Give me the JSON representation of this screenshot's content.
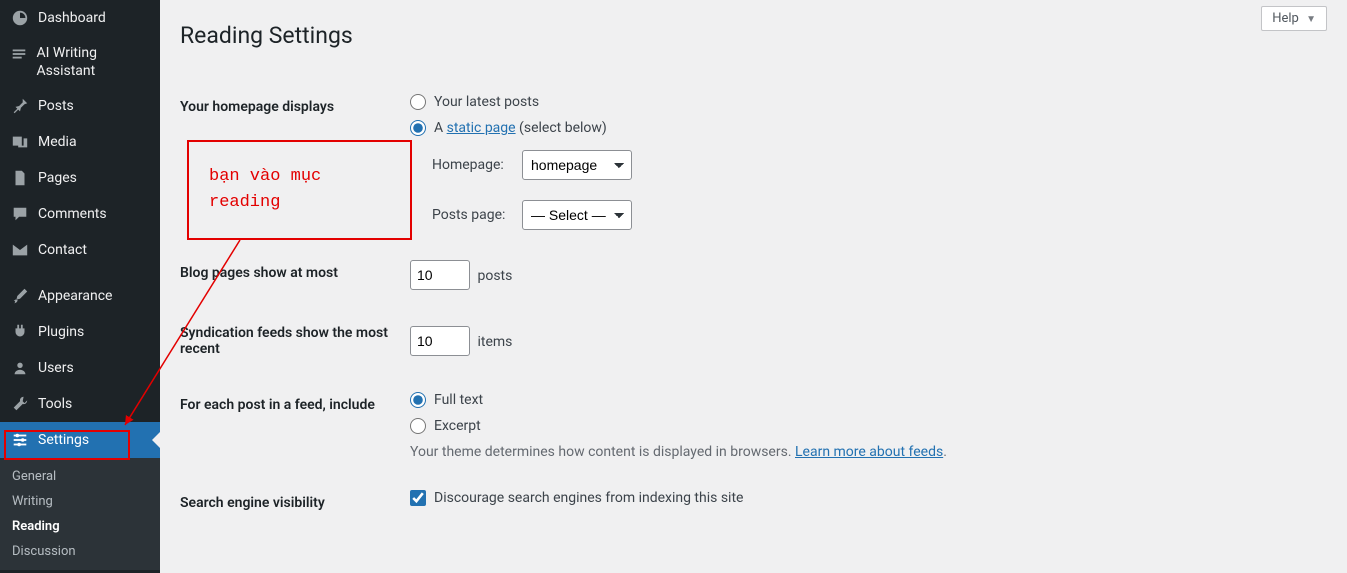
{
  "help_label": "Help",
  "page_title": "Reading Settings",
  "sidebar": {
    "items": [
      {
        "label": "Dashboard"
      },
      {
        "label": "AI Writing Assistant"
      },
      {
        "label": "Posts"
      },
      {
        "label": "Media"
      },
      {
        "label": "Pages"
      },
      {
        "label": "Comments"
      },
      {
        "label": "Contact"
      },
      {
        "label": "Appearance"
      },
      {
        "label": "Plugins"
      },
      {
        "label": "Users"
      },
      {
        "label": "Tools"
      },
      {
        "label": "Settings"
      }
    ],
    "submenu": [
      {
        "label": "General"
      },
      {
        "label": "Writing"
      },
      {
        "label": "Reading"
      },
      {
        "label": "Discussion"
      }
    ]
  },
  "form": {
    "homepage_displays_label": "Your homepage displays",
    "opt_latest_posts": "Your latest posts",
    "opt_static_prefix": "A ",
    "opt_static_link": "static page",
    "opt_static_suffix": " (select below)",
    "homepage_label": "Homepage:",
    "homepage_value": "homepage",
    "postspage_label": "Posts page:",
    "postspage_value": "— Select —",
    "blog_pages_label": "Blog pages show at most",
    "blog_pages_value": "10",
    "blog_pages_suffix": "posts",
    "syndication_label": "Syndication feeds show the most recent",
    "syndication_value": "10",
    "syndication_suffix": "items",
    "feed_include_label": "For each post in a feed, include",
    "feed_full_text": "Full text",
    "feed_excerpt": "Excerpt",
    "feed_desc_prefix": "Your theme determines how content is displayed in browsers. ",
    "feed_desc_link": "Learn more about feeds",
    "feed_desc_suffix": ".",
    "search_visibility_label": "Search engine visibility",
    "search_visibility_opt": "Discourage search engines from indexing this site"
  },
  "annotation": {
    "text1": "bạn vào mục",
    "text2": "reading"
  }
}
